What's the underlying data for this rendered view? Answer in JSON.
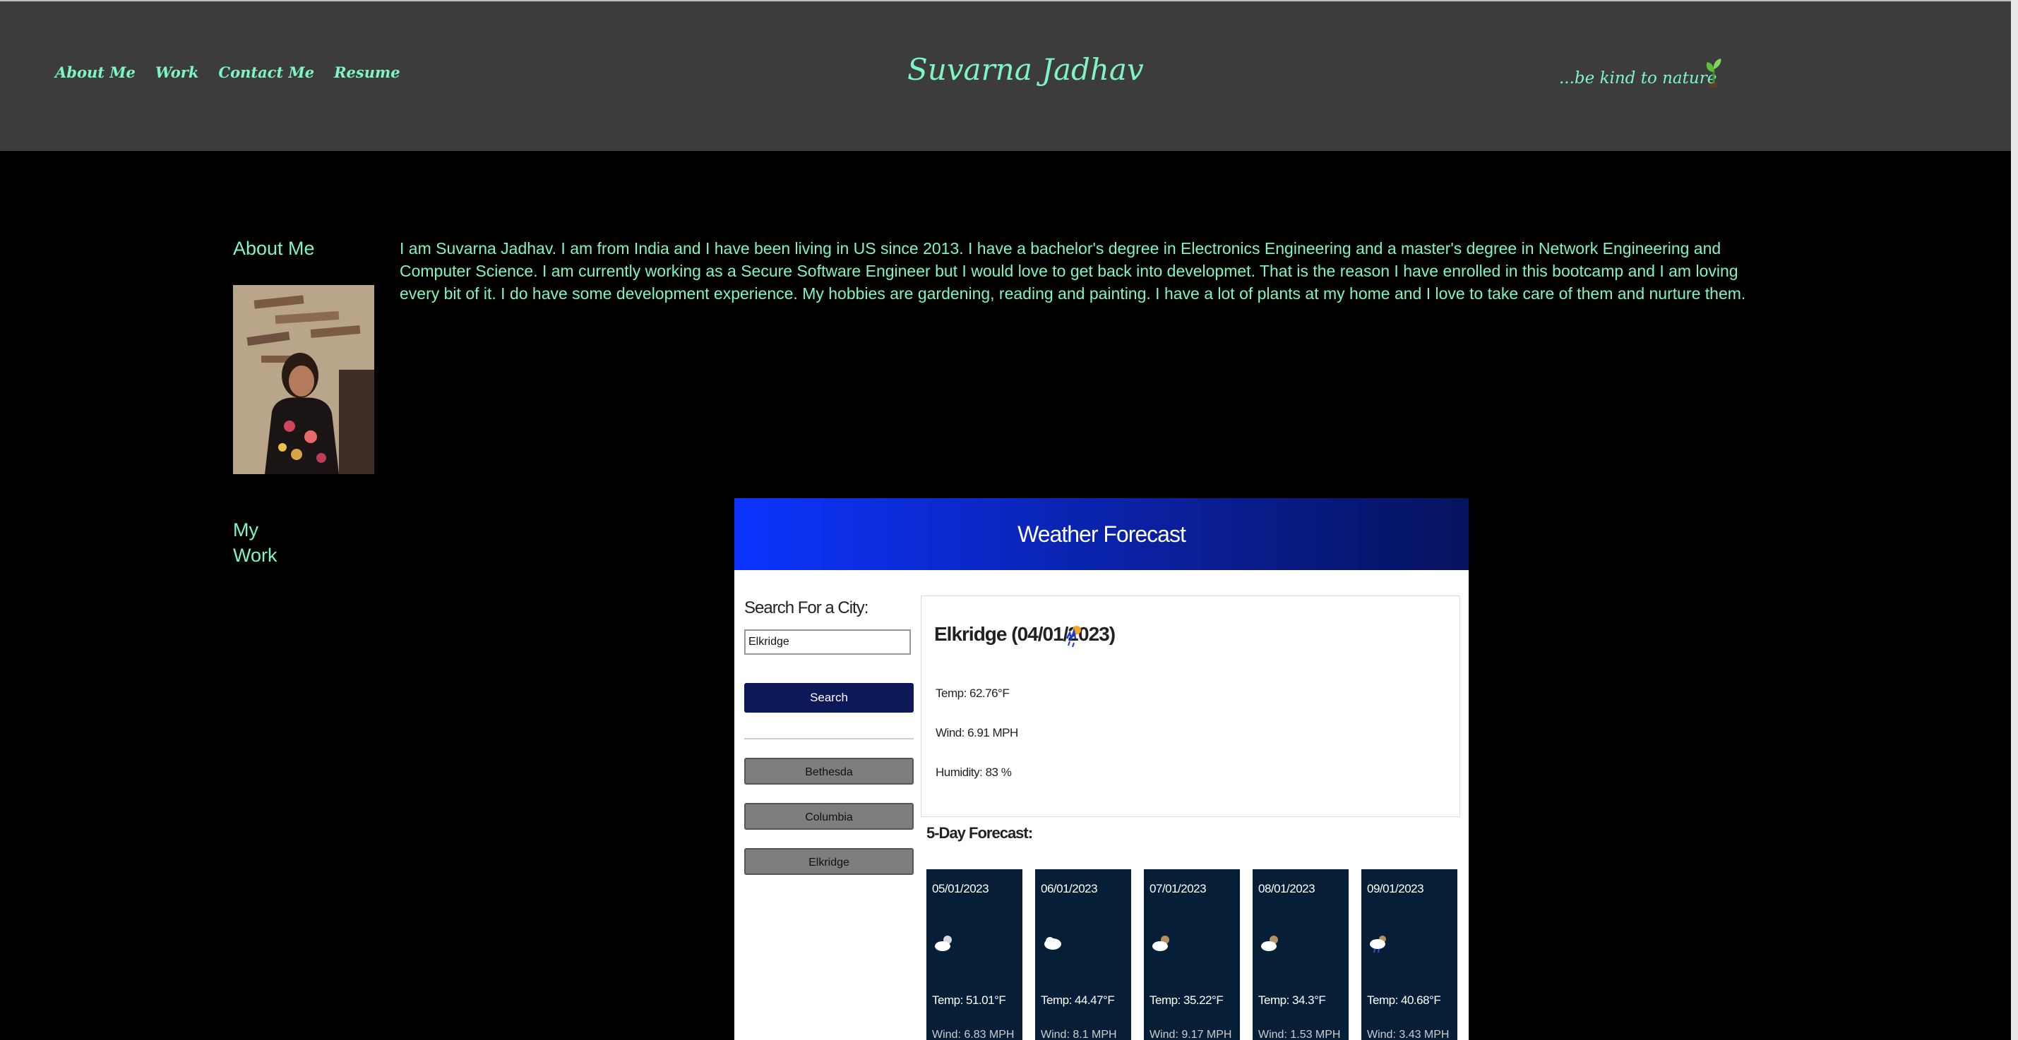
{
  "nav": [
    "About Me",
    "Work",
    "Contact Me",
    "Resume"
  ],
  "site_title": "Suvarna Jadhav",
  "tagline": "...be kind to nature",
  "about": {
    "heading": "About Me",
    "bio": "I am Suvarna Jadhav. I am from India and I have been living in US since 2013. I have a bachelor's degree in Electronics Engineering and a master's degree in Network Engineering and Computer Science. I am currently working as a Secure Software Engineer but I would love to get back into developmet. That is the reason I have enrolled in this bootcamp and I am loving every bit of it. I do have some development experience. My hobbies are gardening, reading and painting. I have a lot of plants at my home and I love to take care of them and nurture them."
  },
  "work": {
    "heading_line1": "My",
    "heading_line2": "Work"
  },
  "weather_app": {
    "title": "Weather Forecast",
    "search_label": "Search For a City:",
    "search_value": "Elkridge",
    "search_button": "Search",
    "history": [
      "Bethesda",
      "Columbia",
      "Elkridge"
    ],
    "current": {
      "city_date": "Elkridge (04/01/2023)",
      "temp": "Temp: 62.76°F",
      "wind": "Wind: 6.91 MPH",
      "humidity": "Humidity: 83 %"
    },
    "five_day_label": "5-Day Forecast:",
    "forecast": [
      {
        "date": "05/01/2023",
        "temp": "Temp: 51.01°F",
        "wind": "Wind: 6.83 MPH"
      },
      {
        "date": "06/01/2023",
        "temp": "Temp: 44.47°F",
        "wind": "Wind: 8.1 MPH"
      },
      {
        "date": "07/01/2023",
        "temp": "Temp: 35.22°F",
        "wind": "Wind: 9.17 MPH"
      },
      {
        "date": "08/01/2023",
        "temp": "Temp: 34.3°F",
        "wind": "Wind: 1.53 MPH"
      },
      {
        "date": "09/01/2023",
        "temp": "Temp: 40.68°F",
        "wind": "Wind: 3.43 MPH"
      }
    ]
  },
  "colors": {
    "accent": "#7ff5c4",
    "header_bg": "#3c3c3c",
    "page_bg": "#000000"
  }
}
